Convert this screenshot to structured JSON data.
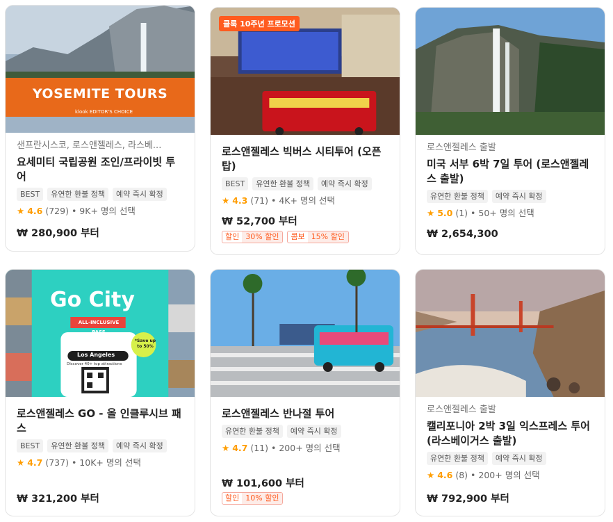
{
  "cards": [
    {
      "location": "샌프란시스코, 로스앤젤레스, 라스베...",
      "title": "요세미티 국립공원 조인/프라이빗 투어",
      "tags": [
        "BEST",
        "유연한 환불 정책",
        "예약 즉시 확정"
      ],
      "rating": "4.6",
      "reviews": "(729)",
      "booked": "• 9K+ 명의 선택",
      "price": "₩ 280,900 부터",
      "image_text": "YOSEMITE TOURS",
      "image_sub": "klook  EDITOR'S CHOICE"
    },
    {
      "ribbon": "클룩 10주년 프로모션",
      "title": "로스앤젤레스 빅버스 시티투어 (오픈탑)",
      "tags": [
        "BEST",
        "유연한 환불 정책",
        "예약 즉시 확정"
      ],
      "rating": "4.3",
      "reviews": "(71)",
      "booked": "• 4K+ 명의 선택",
      "price": "₩ 52,700 부터",
      "promos": [
        {
          "kind": "할인",
          "value": "30% 할인"
        },
        {
          "kind": "콤보",
          "value": "15% 할인"
        }
      ]
    },
    {
      "location": "로스앤젤레스 출발",
      "title": "미국 서부 6박 7일 투어 (로스앤젤레스 출발)",
      "tags": [
        "유연한 환불 정책",
        "예약 즉시 확정"
      ],
      "rating": "5.0",
      "reviews": "(1)",
      "booked": "• 50+ 명의 선택",
      "price": "₩ 2,654,300"
    },
    {
      "title": "로스앤젤레스 GO - 올 인클루시브 패스",
      "tags": [
        "BEST",
        "유연한 환불 정책",
        "예약 즉시 확정"
      ],
      "rating": "4.7",
      "reviews": "(737)",
      "booked": "• 10K+ 명의 선택",
      "price": "₩ 321,200 부터",
      "image_text": "Go City",
      "image_badge": "ALL-INCLUSIVE PASS",
      "image_city": "Los Angeles",
      "image_save": "*Save up to 50%",
      "image_note": "Discover 40+ top attractions"
    },
    {
      "title": "로스앤젤레스 반나절 투어",
      "tags": [
        "유연한 환불 정책",
        "예약 즉시 확정"
      ],
      "rating": "4.7",
      "reviews": "(11)",
      "booked": "• 200+ 명의 선택",
      "price": "₩ 101,600 부터",
      "promos": [
        {
          "kind": "할인",
          "value": "10% 할인"
        }
      ]
    },
    {
      "location": "로스앤젤레스 출발",
      "title": "캘리포니아 2박 3일 익스프레스 투어 (라스베이거스 출발)",
      "tags": [
        "유연한 환불 정책",
        "예약 즉시 확정"
      ],
      "rating": "4.6",
      "reviews": "(8)",
      "booked": "• 200+ 명의 선택",
      "price": "₩ 792,900 부터"
    }
  ],
  "icons": {
    "star": "star-icon"
  },
  "colors": {
    "accent": "#ff5b1f",
    "star": "#ff9d00"
  }
}
